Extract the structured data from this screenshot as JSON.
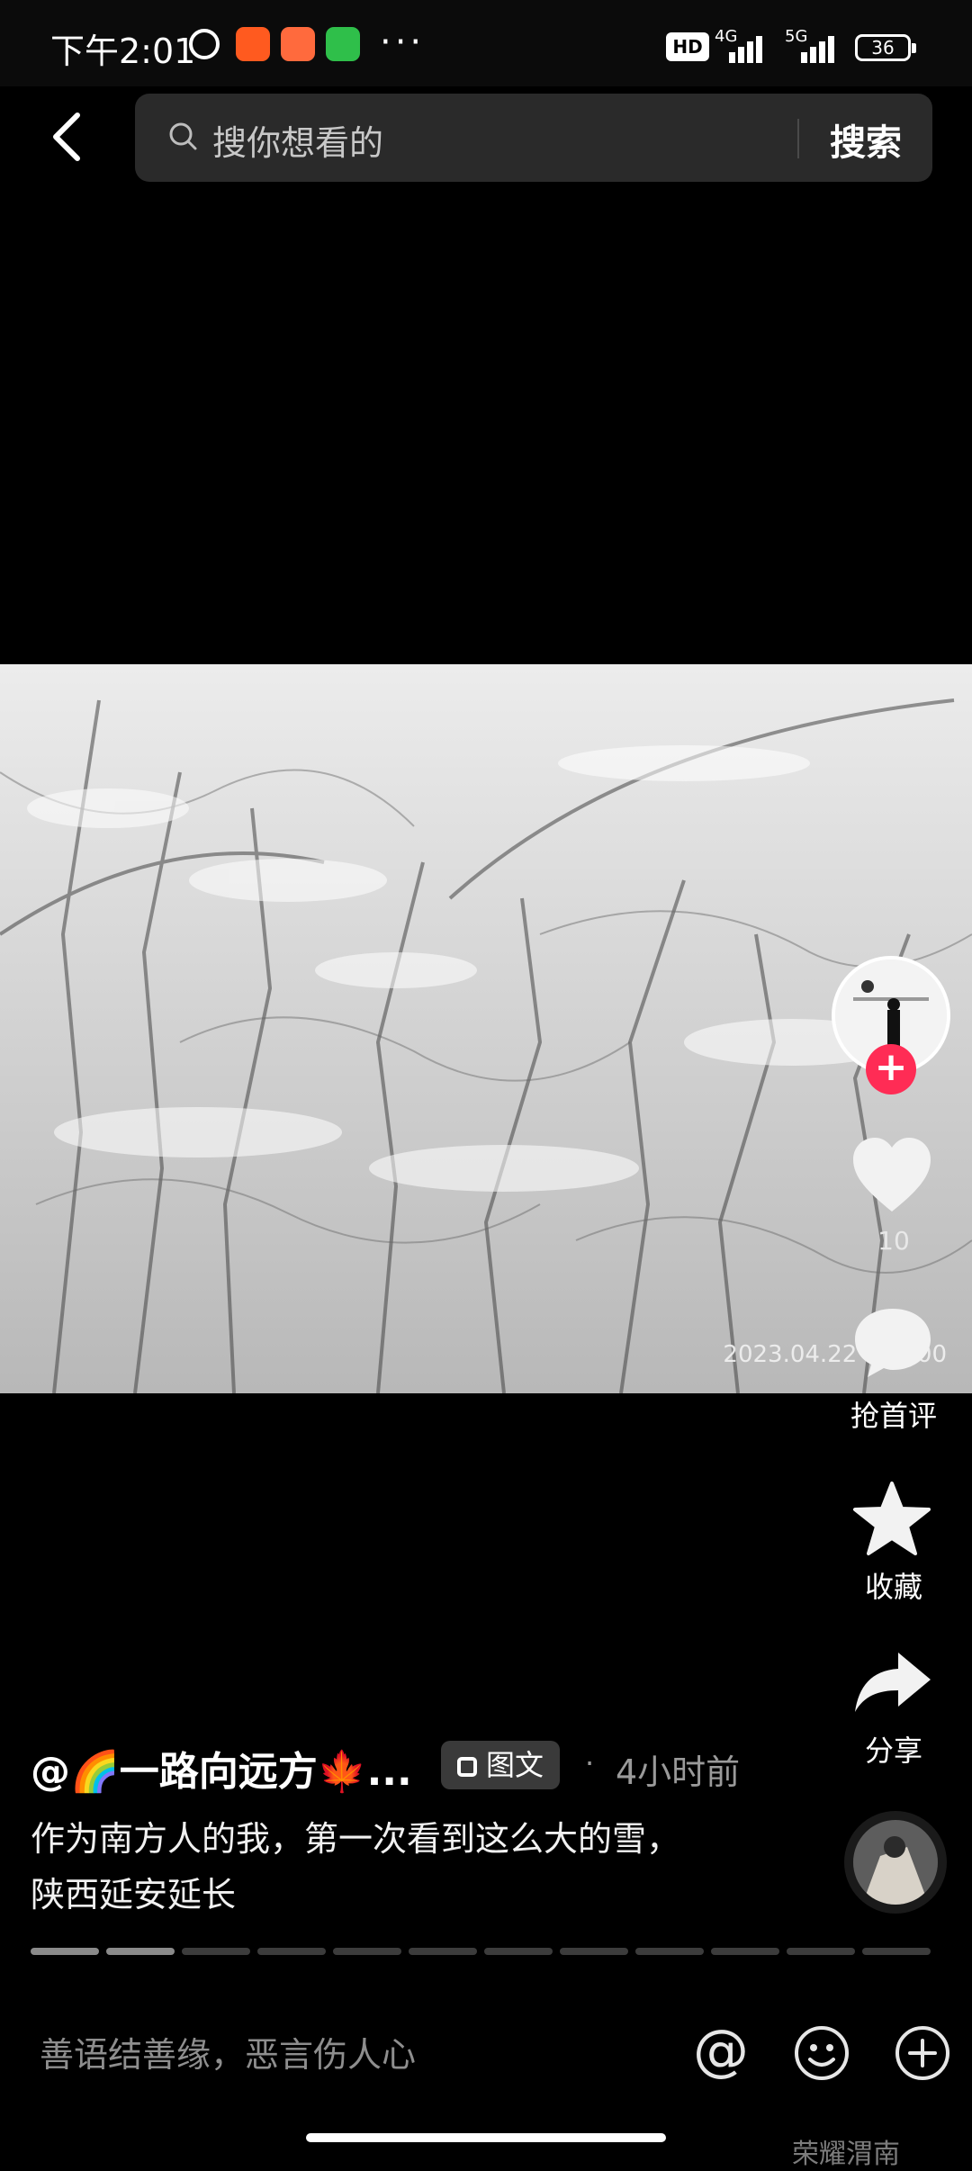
{
  "status_bar": {
    "time": "下午2:01",
    "hd": "HD",
    "net1": "4G",
    "net2": "5G",
    "battery": "36",
    "more": "···"
  },
  "search": {
    "placeholder": "搜你想看的",
    "button": "搜索"
  },
  "media": {
    "timestamp": "2023.04.22 · 06:00"
  },
  "rail": {
    "follow_plus": "+",
    "like_count": "10",
    "comment_label": "抢首评",
    "favorite_label": "收藏",
    "share_label": "分享"
  },
  "post": {
    "author": "@🌈一路向远方🍁...",
    "tag": "图文",
    "dot": "·",
    "time_ago": "4小时前",
    "caption_line1": "作为南方人的我，第一次看到这么大的雪，",
    "caption_line2": "陕西延安延长"
  },
  "progress": {
    "total": 12,
    "done": 2
  },
  "comment_bar": {
    "placeholder": "善语结善缘，恶言伤人心",
    "at": "@"
  },
  "watermark": "荣耀渭南"
}
